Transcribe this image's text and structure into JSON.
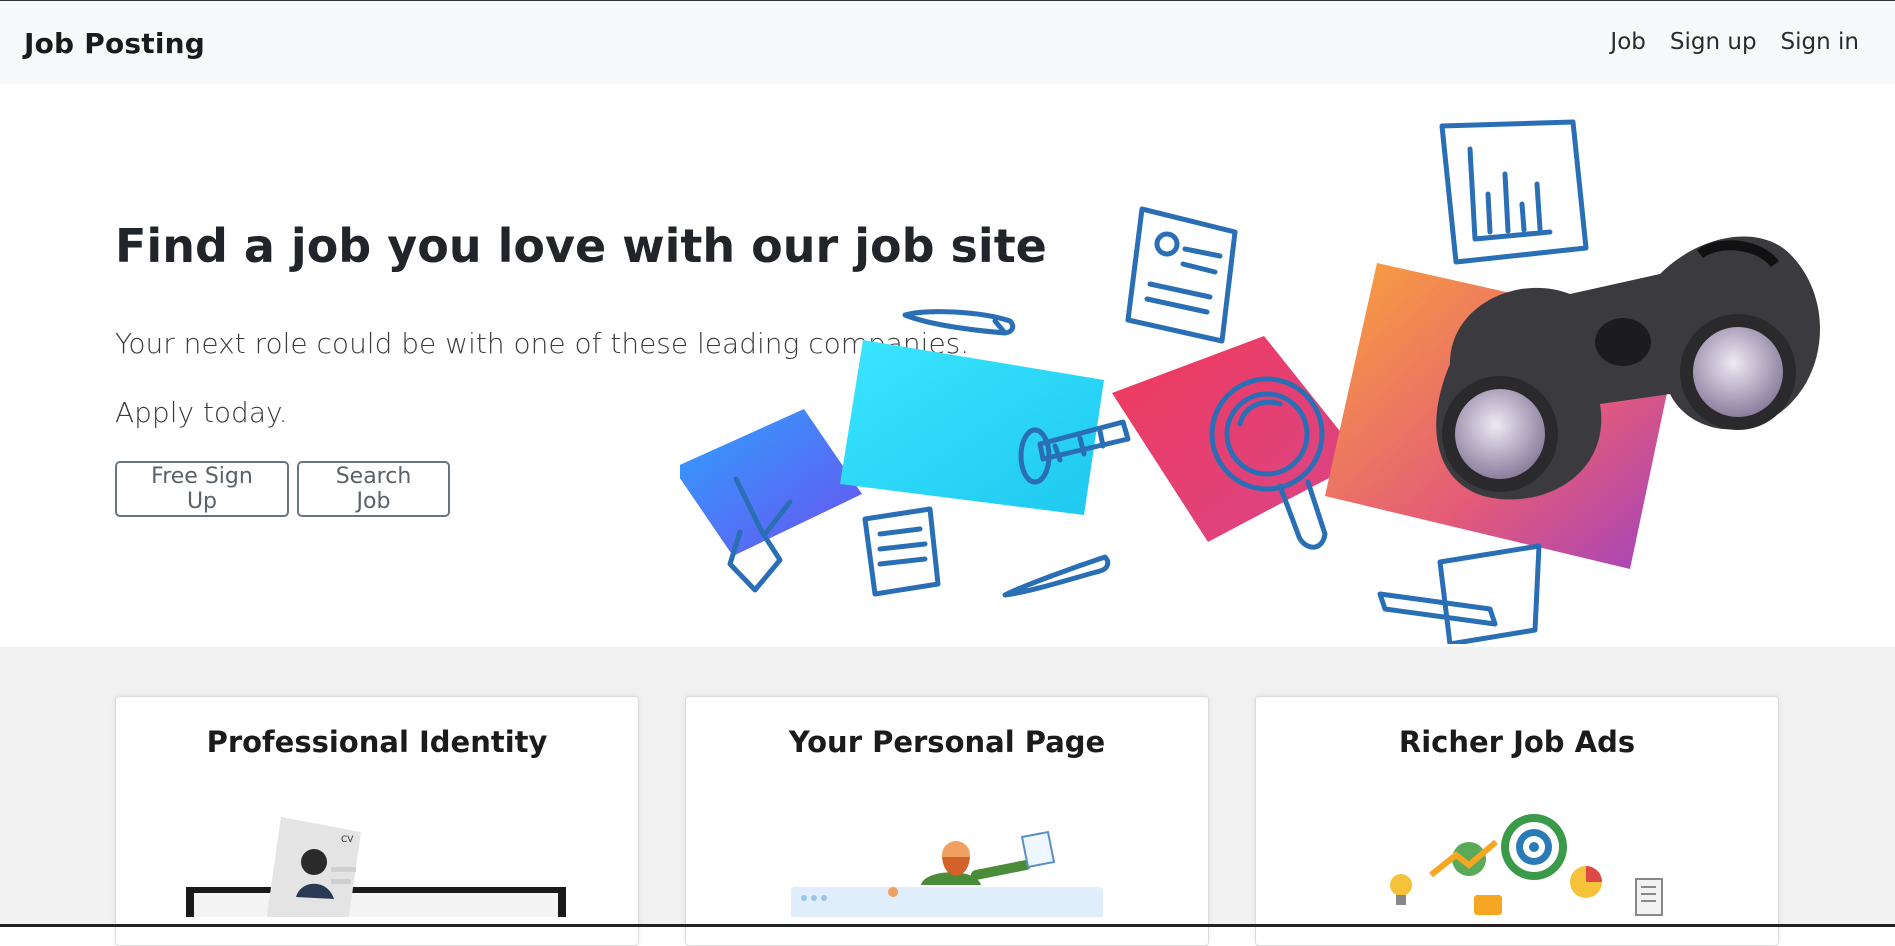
{
  "navbar": {
    "brand": "Job Posting",
    "links": [
      {
        "label": "Job"
      },
      {
        "label": "Sign up"
      },
      {
        "label": "Sign in"
      }
    ]
  },
  "hero": {
    "title": "Find a job you love with our job site",
    "lead": "Your next role could be with one of these leading companies.",
    "lead2": "Apply today.",
    "buttons": {
      "signup": "Free Sign Up",
      "search": "Search Job"
    }
  },
  "features": [
    {
      "title": "Professional Identity"
    },
    {
      "title": "Your Personal Page"
    },
    {
      "title": "Richer Job Ads"
    }
  ],
  "colors": {
    "navbar_bg": "#f8f9fa",
    "accent_blue": "#2a6fb5",
    "cyan": "#36d3f0",
    "pink": "#ec4a6c",
    "orange": "#f7a440"
  }
}
